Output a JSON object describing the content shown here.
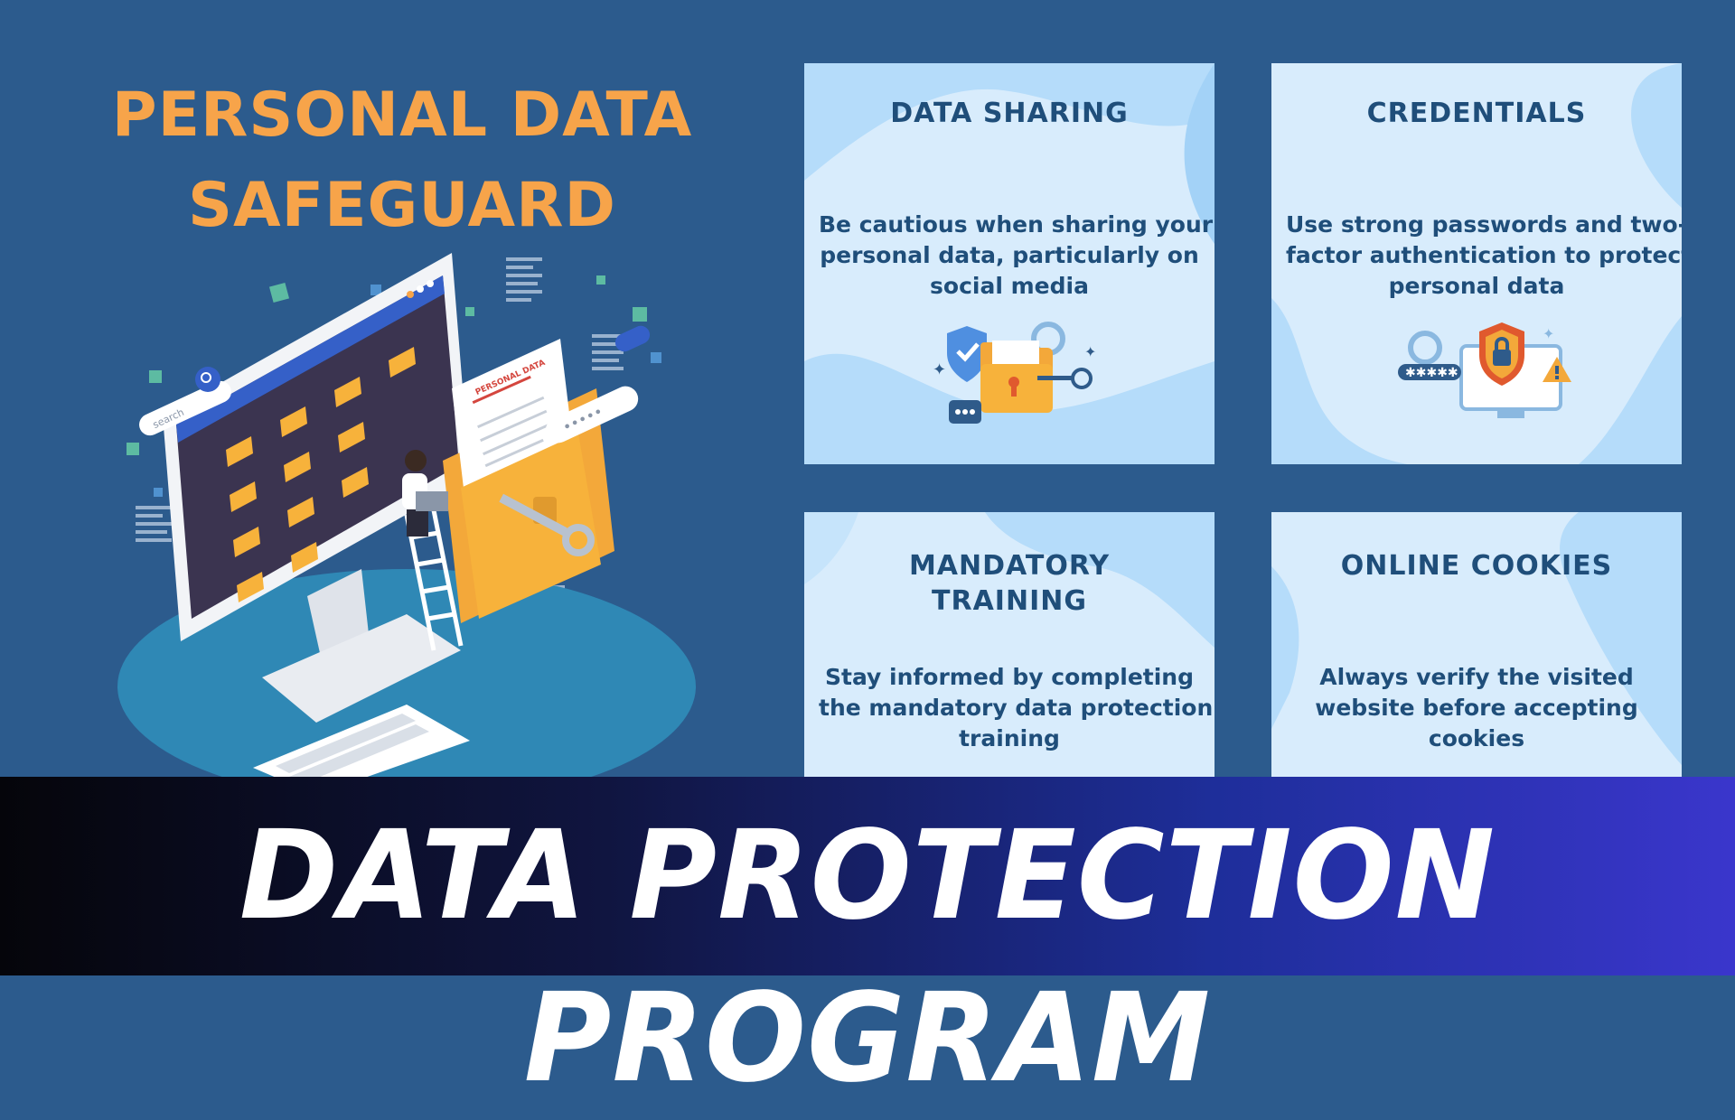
{
  "header": {
    "title_line1": "PERSONAL DATA",
    "title_line2": "SAFEGUARD"
  },
  "illustration": {
    "document_label": "PERSONAL DATA",
    "search_placeholder": "search",
    "password_mask": "•••••"
  },
  "cards": [
    {
      "title_lines": [
        "DATA SHARING"
      ],
      "text_lines": [
        "Be cautious when sharing your",
        "personal data, particularly on",
        "social media"
      ],
      "icon": "shield-folder-key-icon"
    },
    {
      "title_lines": [
        "CREDENTIALS"
      ],
      "text_lines": [
        "Use strong passwords and two-",
        "factor authentication to protect",
        "personal data"
      ],
      "icon": "password-lock-monitor-icon"
    },
    {
      "title_lines": [
        "MANDATORY",
        "TRAINING"
      ],
      "text_lines": [
        "Stay informed by completing",
        "the mandatory data protection",
        "training"
      ]
    },
    {
      "title_lines": [
        "ONLINE COOKIES"
      ],
      "text_lines": [
        "Always verify the visited",
        "website before accepting",
        "cookies"
      ]
    }
  ],
  "banner": {
    "text": "DATA PROTECTION PROGRAM"
  },
  "colors": {
    "background": "#2c5b8d",
    "title_orange": "#f7a44a",
    "card_bg": "#d8ecfc",
    "card_text": "#1f4e7a",
    "banner_start": "#05050a",
    "banner_end": "#3a36cc"
  }
}
